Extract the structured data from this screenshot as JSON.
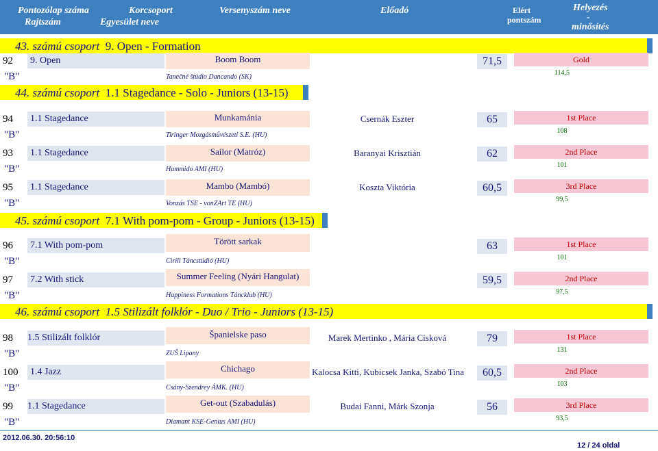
{
  "header": {
    "col1a": "Pontozólap száma",
    "col1b": "Rajtszám",
    "col2a": "Korcsoport",
    "col2b": "Egyesület neve",
    "col3": "Versenyszám neve",
    "col4": "Előadó",
    "col5a": "Elért",
    "col5b": "pontszám",
    "col6a": "Helyezés",
    "col6b": "-",
    "col6c": "minősítés"
  },
  "groups": [
    {
      "label": "43. számú csoport",
      "name": "9. Open - Formation"
    },
    {
      "label": "44. számú csoport",
      "name": "1.1 Stagedance - Solo - Juniors (13-15)"
    },
    {
      "label": "45. számú csoport",
      "name": "7.1 With pom-pom - Group - Juniors (13-15)"
    },
    {
      "label": "46. számú csoport",
      "name": "1.5 Stilizált folklór - Duo / Trio - Juniors (13-15)"
    }
  ],
  "entries": [
    {
      "num": "92",
      "level": "\"B\"",
      "category": "9. Open",
      "title": "Boom Boom",
      "club": "Tanečné štúdio Dancando (SK)",
      "trainer": "",
      "points": "71,5",
      "place": "Gold",
      "sum": "114,5"
    },
    {
      "num": "94",
      "level": "\"B\"",
      "category": "1.1 Stagedance",
      "title": "Munkamánia",
      "club": "Tiringer Mozgásművészeti S.E. (HU)",
      "trainer": "Csernák Eszter",
      "points": "65",
      "place": "1st Place",
      "sum": "108"
    },
    {
      "num": "93",
      "level": "\"B\"",
      "category": "1.1 Stagedance",
      "title": "Sailor (Matróz)",
      "club": "Hammido AMI (HU)",
      "trainer": "Baranyai Krisztián",
      "points": "62",
      "place": "2nd Place",
      "sum": "101"
    },
    {
      "num": "95",
      "level": "\"B\"",
      "category": "1.1 Stagedance",
      "title": "Mambo (Mambó)",
      "club": "Vonzás TSE - vonZArt TE  (HU)",
      "trainer": "Koszta Viktória",
      "points": "60,5",
      "place": "3rd Place",
      "sum": "99,5"
    },
    {
      "num": "96",
      "level": "\"B\"",
      "category": "7.1 With pom-pom",
      "title": "Törött sarkak",
      "club": "Cirill Táncstúdió (HU)",
      "trainer": "",
      "points": "63",
      "place": "1st Place",
      "sum": "101"
    },
    {
      "num": "97",
      "level": "\"B\"",
      "category": "7.2 With stick",
      "title": "Summer Feeling  (Nyári Hangulat)",
      "club": "Happiness Formations Táncklub (HU)",
      "trainer": "",
      "points": "59,5",
      "place": "2nd Place",
      "sum": "97,5"
    },
    {
      "num": "98",
      "level": "\"B\"",
      "category": "1.5 Stilizált folklór",
      "title": "Španielske paso",
      "club": "ZUŠ Lipany",
      "trainer": "Marek Mertinko , Mária Cisková",
      "points": "79",
      "place": "1st Place",
      "sum": "131"
    },
    {
      "num": "100",
      "level": "\"B\"",
      "category": "1.4 Jazz",
      "title": "Chichago",
      "club": "Csány-Szendrey ÁMK. (HU)",
      "trainer": "Kalocsa Kitti, Kubicsek Janka, Szabó Tina",
      "points": "60,5",
      "place": "2nd Place",
      "sum": "103"
    },
    {
      "num": "99",
      "level": "\"B\"",
      "category": "1.1 Stagedance",
      "title": "Get-out (Szabadulás)",
      "club": "Diamant KSE-Genius AMI (HU)",
      "trainer": "Budai Fanni, Márk Szonja",
      "points": "56",
      "place": "3rd Place",
      "sum": "93,5"
    }
  ],
  "footer": {
    "timestamp": "2012.06.30. 20:56:10",
    "page": "12 / 24 oldal"
  },
  "colors": {
    "header": "#3d7fbf",
    "group": "#ffff00",
    "title_bg": "#fbe4d7",
    "place_bg": "#f7c6d4",
    "place_text": "#c00000",
    "sum_text": "#006600"
  }
}
